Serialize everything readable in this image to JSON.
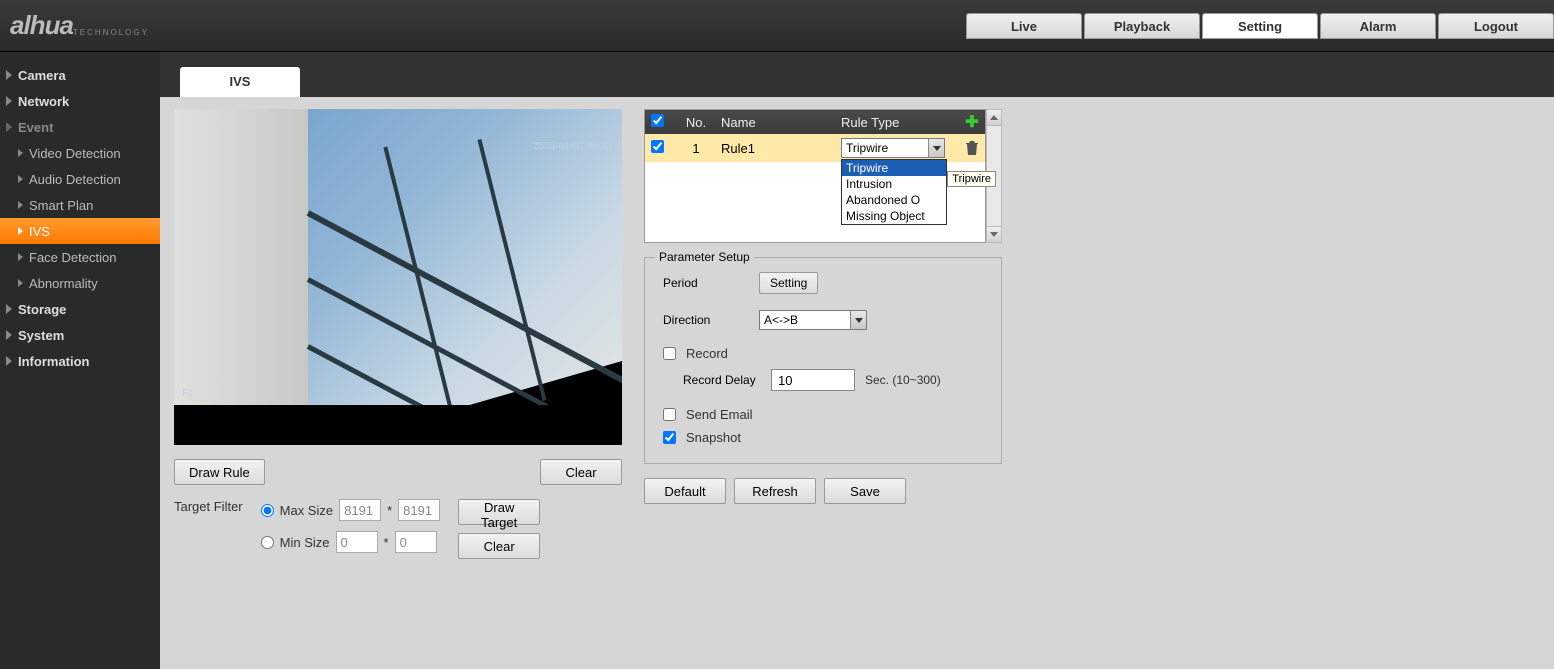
{
  "brand": {
    "name": "alhua",
    "sub": "TECHNOLOGY"
  },
  "topnav": {
    "live": "Live",
    "playback": "Playback",
    "setting": "Setting",
    "alarm": "Alarm",
    "logout": "Logout"
  },
  "sidebar": {
    "camera": "Camera",
    "network": "Network",
    "event": "Event",
    "video_detection": "Video Detection",
    "audio_detection": "Audio Detection",
    "smart_plan": "Smart Plan",
    "ivs": "IVS",
    "face_detection": "Face Detection",
    "abnormality": "Abnormality",
    "storage": "Storage",
    "system": "System",
    "information": "Information"
  },
  "tab": {
    "ivs": "IVS"
  },
  "video": {
    "timestamp": "2555-01-01 08:53",
    "label": "Fc"
  },
  "buttons": {
    "draw_rule": "Draw Rule",
    "clear": "Clear",
    "draw_target": "Draw Target",
    "setting": "Setting",
    "default": "Default",
    "refresh": "Refresh",
    "save": "Save"
  },
  "filter": {
    "label": "Target Filter",
    "max": "Max Size",
    "min": "Min Size",
    "max_w": "8191",
    "max_h": "8191",
    "min_w": "0",
    "min_h": "0"
  },
  "rules": {
    "head_no": "No.",
    "head_name": "Name",
    "head_type": "Rule Type",
    "row_no": "1",
    "row_name": "Rule1",
    "row_type": "Tripwire",
    "opts": {
      "tripwire": "Tripwire",
      "intrusion": "Intrusion",
      "abandoned": "Abandoned O",
      "missing": "Missing Object"
    },
    "tooltip": "Tripwire"
  },
  "params": {
    "legend": "Parameter Setup",
    "period": "Period",
    "direction": "Direction",
    "direction_val": "A<->B",
    "record": "Record",
    "record_delay": "Record Delay",
    "record_delay_val": "10",
    "record_delay_hint": "Sec. (10~300)",
    "send_email": "Send Email",
    "snapshot": "Snapshot"
  }
}
